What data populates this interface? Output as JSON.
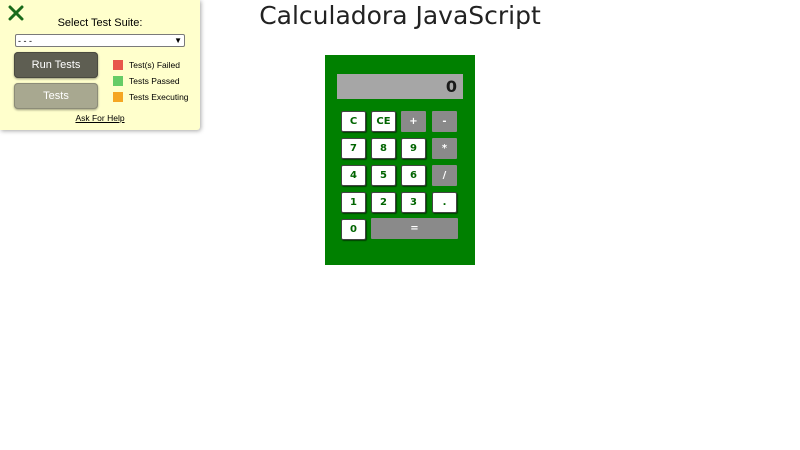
{
  "test_panel": {
    "close_icon": "close-x-icon",
    "title": "Select Test Suite:",
    "selected_suite": "- - -",
    "run_button": "Run Tests",
    "tests_button": "Tests",
    "legend": [
      {
        "label": "Test(s) Failed",
        "color": "#e8574b"
      },
      {
        "label": "Tests Passed",
        "color": "#66cc66"
      },
      {
        "label": "Tests Executing",
        "color": "#f5a623"
      }
    ],
    "help_link": "Ask For Help"
  },
  "app": {
    "title": "Calculadora JavaScript"
  },
  "calculator": {
    "display": "0",
    "keys": {
      "clear": "C",
      "clear_entry": "CE",
      "plus": "+",
      "minus": "-",
      "seven": "7",
      "eight": "8",
      "nine": "9",
      "multiply": "*",
      "four": "4",
      "five": "5",
      "six": "6",
      "divide": "/",
      "one": "1",
      "two": "2",
      "three": "3",
      "decimal": ".",
      "zero": "0",
      "equals": "="
    }
  },
  "colors": {
    "panel_bg": "#ffffcc",
    "calc_bg": "#008000",
    "display_bg": "#a6a6a6",
    "operator_key": "#8a8a8a"
  }
}
